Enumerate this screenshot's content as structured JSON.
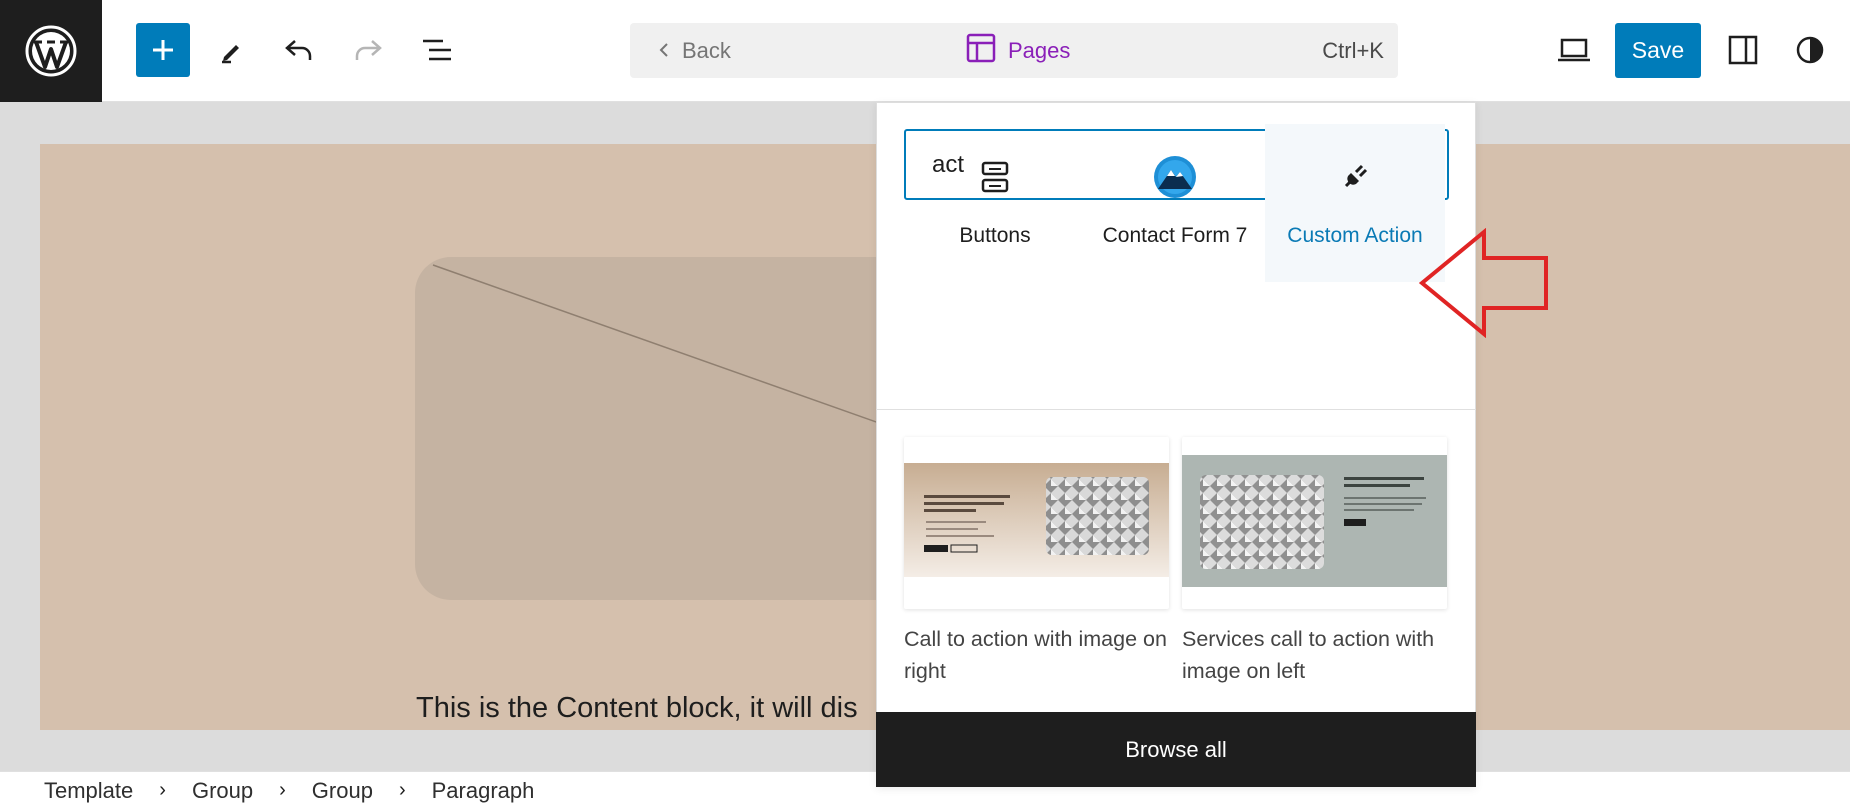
{
  "toolbar": {
    "command_back": "Back",
    "command_title": "Pages",
    "command_shortcut": "Ctrl+K",
    "save_label": "Save"
  },
  "canvas": {
    "content_text": "This is the Content block, it will dis"
  },
  "inserter": {
    "search_value": "act",
    "blocks": [
      {
        "label": "Buttons",
        "icon": "buttons-icon"
      },
      {
        "label": "Contact Form 7",
        "icon": "contact-form-7-icon"
      },
      {
        "label": "Custom Action",
        "icon": "plug-icon"
      }
    ],
    "patterns": [
      {
        "caption": "Call to action with image on right"
      },
      {
        "caption": "Services call to action with image on left"
      }
    ],
    "browse_all": "Browse all"
  },
  "breadcrumb": [
    "Template",
    "Group",
    "Group",
    "Paragraph"
  ],
  "colors": {
    "accent": "#007cba",
    "pages_purple": "#8a1fb8",
    "annotation_red": "#e02424"
  }
}
